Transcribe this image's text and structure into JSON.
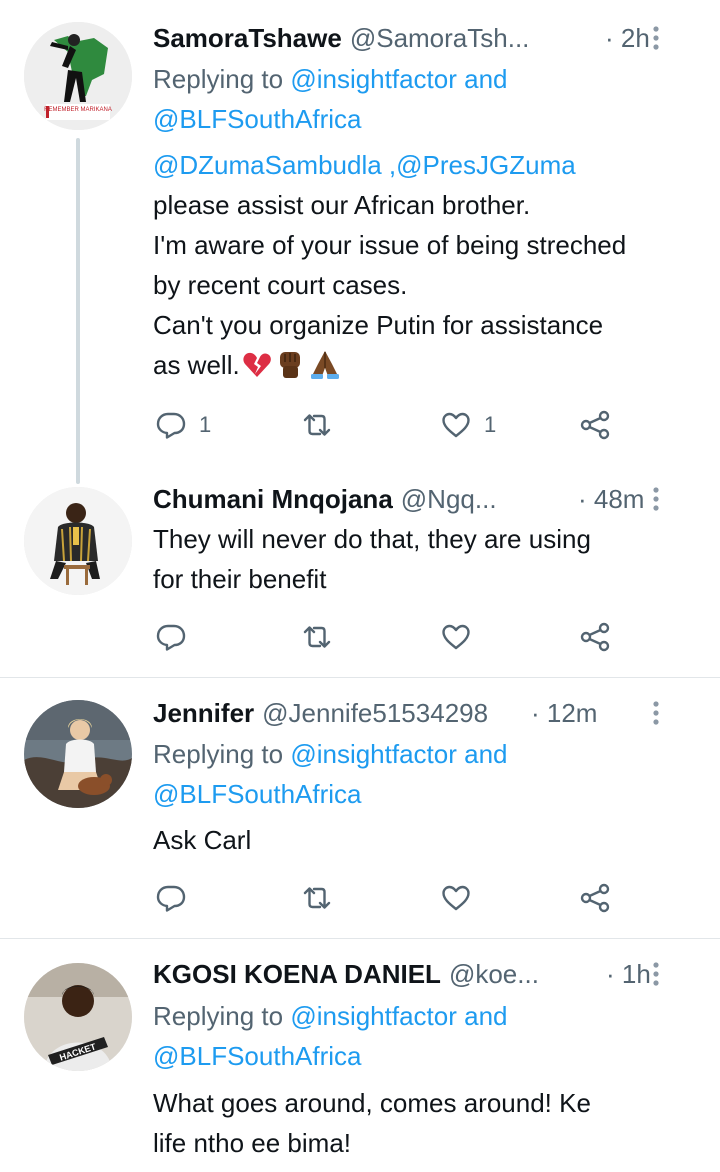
{
  "tweets": [
    {
      "name": "SamoraTshawe",
      "handle": "@SamoraTsh...",
      "time": "· 2h",
      "avatar_text": "REMEMBER MARIKANA",
      "replying_prefix": "Replying to",
      "replying_users": "@insightfactor and",
      "replying_users2": "@BLFSouthAfrica",
      "body": [
        "@DZumaSambudla ,@PresJGZuma",
        "please assist our African brother.",
        "I'm aware of your issue of being streched",
        "by recent court cases.",
        "Can't you organize Putin for assistance",
        "as well."
      ],
      "body_mentions": "@DZumaSambudla ,@PresJGZuma",
      "emojis": [
        "broken-heart",
        "raised-fist",
        "folded-hands"
      ],
      "reply_count": "1",
      "like_count": "1"
    },
    {
      "name": "Chumani Mnqojana",
      "handle": "@Ngq...",
      "time": "· 48m",
      "body": [
        "They will never do that,  they are using",
        "for their benefit"
      ]
    },
    {
      "name": "Jennifer",
      "handle": "@Jennife51534298",
      "time": "· 12m",
      "replying_prefix": "Replying to",
      "replying_users": "@insightfactor and",
      "replying_users2": "@BLFSouthAfrica",
      "body": [
        "Ask Carl"
      ]
    },
    {
      "name": "KGOSI KOENA DANIEL",
      "handle": "@koe...",
      "time": "· 1h",
      "avatar_text": "HACKET",
      "replying_prefix": "Replying to",
      "replying_users": "@insightfactor and",
      "replying_users2": "@BLFSouthAfrica",
      "body": [
        "What goes around, comes around! Ke",
        "life ntho ee bima!"
      ]
    }
  ],
  "colors": {
    "text": "#0f1419",
    "secondary": "#536471",
    "link": "#1d9bf0",
    "divider": "#e2e6e9",
    "thread_line": "#cfd9de"
  },
  "icons": [
    "reply-icon",
    "retweet-icon",
    "like-icon",
    "share-icon",
    "more-options-icon"
  ]
}
